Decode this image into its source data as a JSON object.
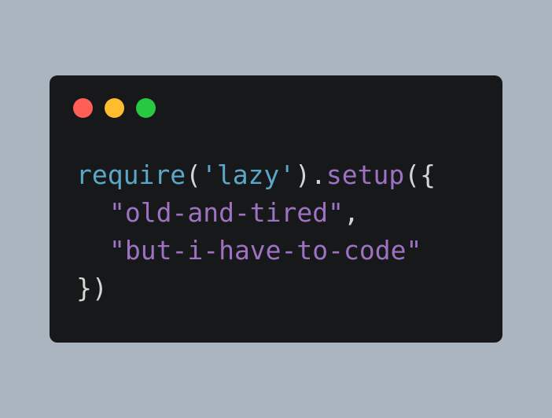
{
  "colors": {
    "background": "#abb5bf",
    "window": "#171819",
    "close": "#ff5f57",
    "minimize": "#febc2e",
    "maximize": "#28c840",
    "function": "#5ba7c9",
    "method": "#9e72c3",
    "string": "#9e72c3",
    "punctuation": "#d4d4d4"
  },
  "window_controls": [
    "close",
    "minimize",
    "maximize"
  ],
  "code": {
    "line1": {
      "fn": "require",
      "open_paren": "(",
      "arg": "'lazy'",
      "close_dot": ").",
      "method": "setup",
      "open": "({"
    },
    "line2": {
      "string": "\"old-and-tired\"",
      "comma": ","
    },
    "line3": {
      "string": "\"but-i-have-to-code\""
    },
    "line4": {
      "close": "})"
    }
  }
}
